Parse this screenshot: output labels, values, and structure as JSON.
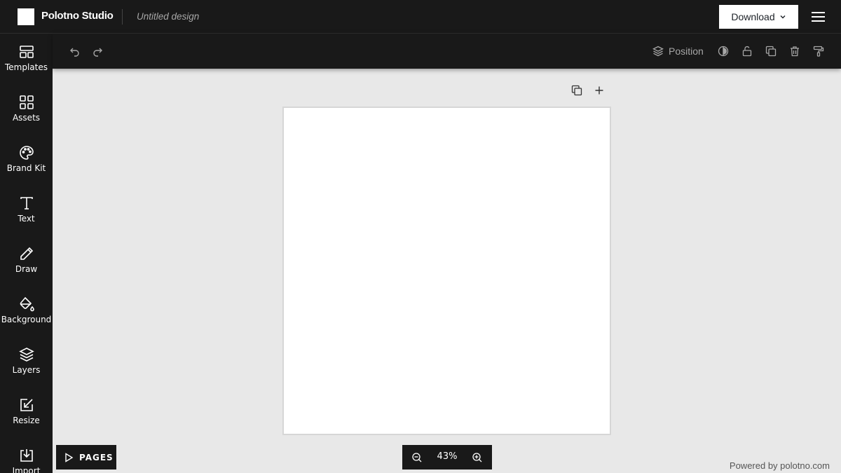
{
  "header": {
    "app_title": "Polotno Studio",
    "document_name": "Untitled design",
    "download_label": "Download",
    "menu_icon": "hamburger-menu-icon"
  },
  "sidebar": {
    "items": [
      {
        "label": "Templates",
        "icon": "templates-icon"
      },
      {
        "label": "Assets",
        "icon": "assets-grid-icon"
      },
      {
        "label": "Brand Kit",
        "icon": "palette-icon"
      },
      {
        "label": "Text",
        "icon": "text-icon"
      },
      {
        "label": "Draw",
        "icon": "pencil-icon"
      },
      {
        "label": "Background",
        "icon": "paint-bucket-icon"
      },
      {
        "label": "Layers",
        "icon": "layers-icon"
      },
      {
        "label": "Resize",
        "icon": "resize-icon"
      },
      {
        "label": "Import",
        "icon": "import-icon"
      }
    ]
  },
  "toolbar": {
    "position_label": "Position",
    "icons": [
      "undo-icon",
      "redo-icon",
      "layers-icon",
      "opacity-icon",
      "unlock-icon",
      "duplicate-icon",
      "trash-icon",
      "paint-roller-icon"
    ]
  },
  "canvas": {
    "page_actions": [
      "duplicate-page-icon",
      "add-page-icon"
    ]
  },
  "footer": {
    "pages_label": "PAGES",
    "zoom_value": "43%",
    "powered_by": "Powered by polotno.com"
  },
  "colors": {
    "dark_bg": "#191919",
    "workspace_bg": "#e8e8e8",
    "muted_text": "#a7a7a7",
    "page_bg": "#ffffff"
  }
}
